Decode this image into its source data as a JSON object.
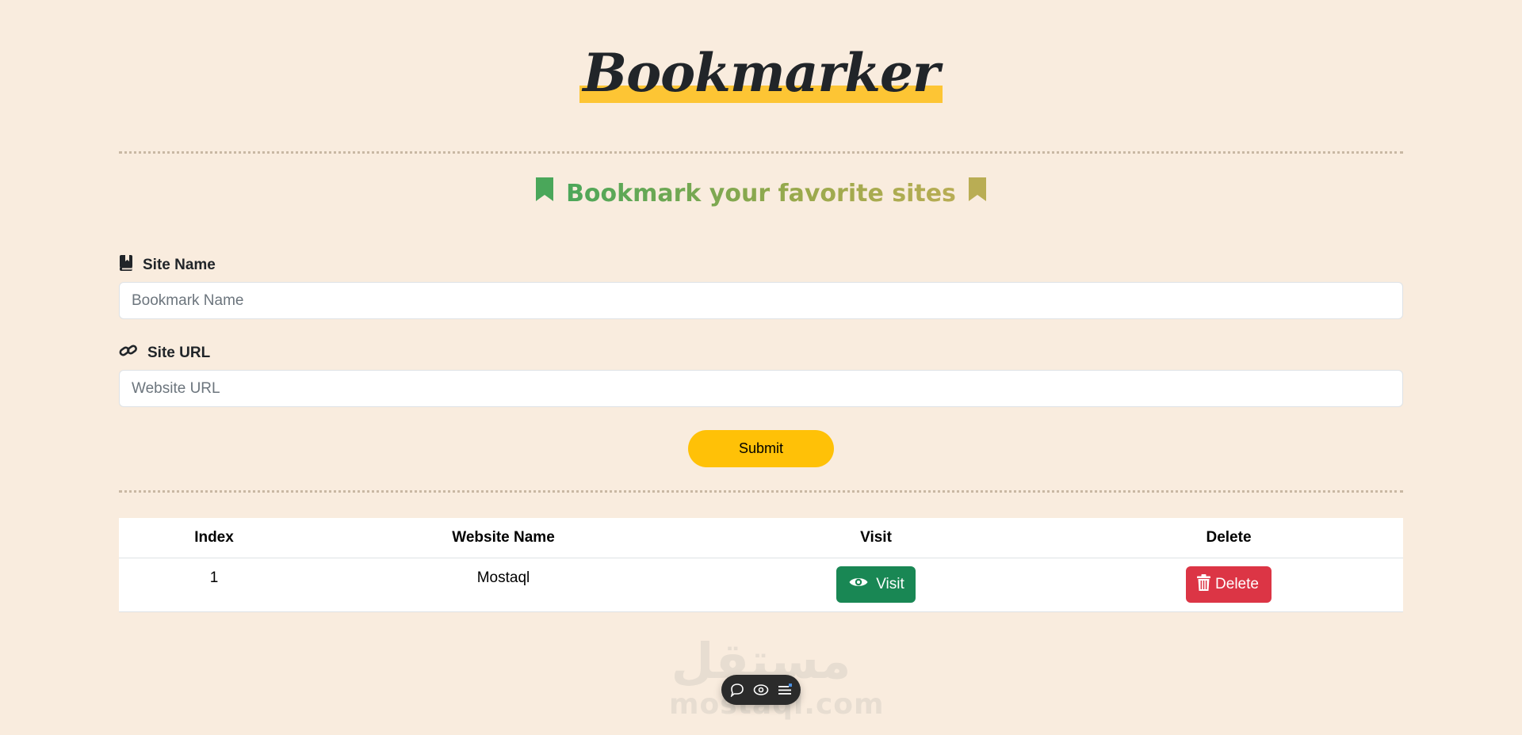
{
  "brand": {
    "title": "Bookmarker"
  },
  "tagline": {
    "text": "Bookmark your favorite sites"
  },
  "form": {
    "site_name_label": "Site Name",
    "site_name_placeholder": "Bookmark Name",
    "site_url_label": "Site URL",
    "site_url_placeholder": "Website URL",
    "submit_label": "Submit"
  },
  "table": {
    "headers": [
      "Index",
      "Website Name",
      "Visit",
      "Delete"
    ],
    "rows": [
      {
        "index": "1",
        "name": "Mostaql",
        "visit_label": "Visit",
        "delete_label": "Delete"
      }
    ]
  },
  "watermark": {
    "arabic": "مستقل",
    "latin": "mostaql.com"
  },
  "colors": {
    "background": "#f9ecde",
    "brand_highlight": "#fdc534",
    "submit": "#ffc107",
    "visit": "#198754",
    "delete": "#dc3545",
    "tagline_start": "#4aa75a",
    "tagline_end": "#b9ad54"
  },
  "icons": {
    "site_name": "book-bookmark-icon",
    "site_url": "link-icon",
    "tagline_left": "bookmark-icon",
    "tagline_right": "bookmark-icon",
    "visit": "eye-icon",
    "delete": "trash-icon",
    "toolbar": [
      "comment-icon",
      "view-icon",
      "menu-icon"
    ]
  }
}
